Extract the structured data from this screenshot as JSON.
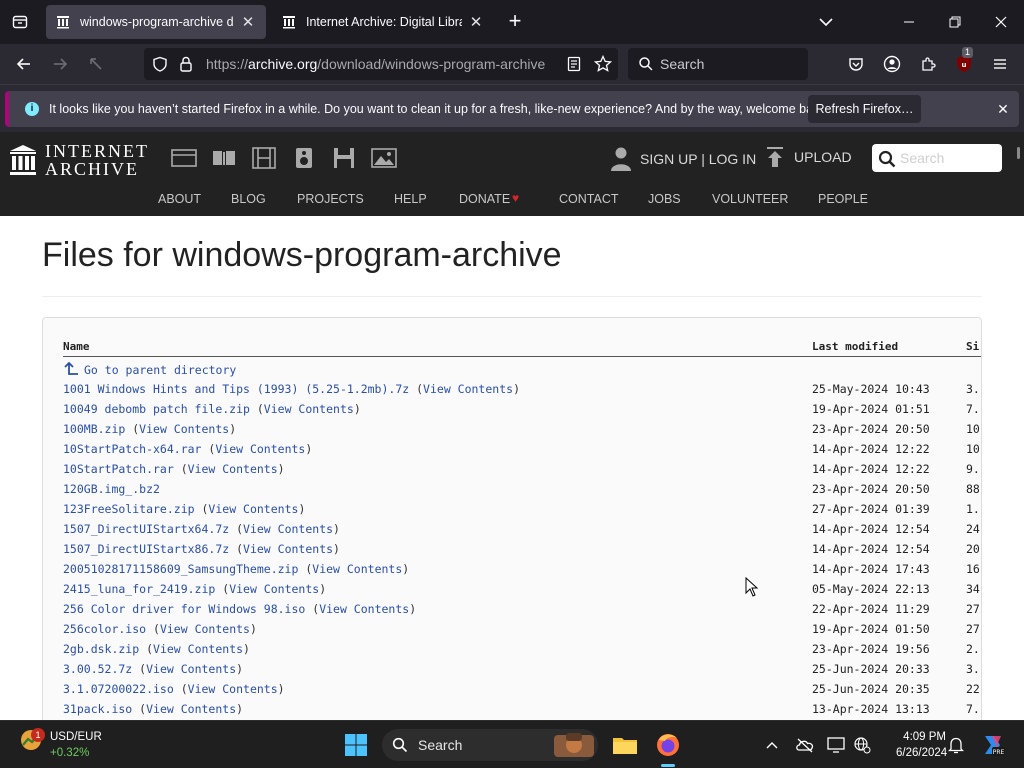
{
  "browser": {
    "tabs": [
      {
        "label": "windows-program-archive directory listing",
        "active": true
      },
      {
        "label": "Internet Archive: Digital Library of Free & Borrowable",
        "active": false
      }
    ],
    "url_prefix": "https://",
    "url_host": "archive.org",
    "url_path": "/download/windows-program-archive",
    "search_placeholder": "Search",
    "extension_badge": "1",
    "notification": {
      "message": "It looks like you haven’t started Firefox in a while. Do you want to clean it up for a fresh, like-new experience? And by the way, welcome back!",
      "button": "Refresh Firefox…"
    }
  },
  "archive": {
    "logo_line1": "INTERNET",
    "logo_line2": "ARCHIVE",
    "signup": "SIGN UP | LOG IN",
    "upload": "UPLOAD",
    "search_placeholder": "Search",
    "nav": [
      "ABOUT",
      "BLOG",
      "PROJECTS",
      "HELP",
      "DONATE",
      "CONTACT",
      "JOBS",
      "VOLUNTEER",
      "PEOPLE"
    ],
    "accent": "#d9262c"
  },
  "page": {
    "title": "Files for windows-program-archive",
    "columns": {
      "name": "Name",
      "modified": "Last modified",
      "size": "Si"
    },
    "parent": "Go to parent directory",
    "view_label": "View Contents",
    "rows": [
      {
        "name": "1001 Windows Hints and Tips (1993) (5.25-1.2mb).7z",
        "view": true,
        "date": "25-May-2024 10:43",
        "size": "3."
      },
      {
        "name": "10049 debomb patch file.zip",
        "view": true,
        "date": "19-Apr-2024 01:51",
        "size": "7."
      },
      {
        "name": "100MB.zip",
        "view": true,
        "date": "23-Apr-2024 20:50",
        "size": "10"
      },
      {
        "name": "10StartPatch-x64.rar",
        "view": true,
        "date": "14-Apr-2024 12:22",
        "size": "10"
      },
      {
        "name": "10StartPatch.rar",
        "view": true,
        "date": "14-Apr-2024 12:22",
        "size": "9."
      },
      {
        "name": "120GB.img_.bz2",
        "view": false,
        "date": "23-Apr-2024 20:50",
        "size": "88"
      },
      {
        "name": "123FreeSolitare.zip",
        "view": true,
        "date": "27-Apr-2024 01:39",
        "size": "1."
      },
      {
        "name": "1507_DirectUIStartx64.7z",
        "view": true,
        "date": "14-Apr-2024 12:54",
        "size": "24"
      },
      {
        "name": "1507_DirectUIStartx86.7z",
        "view": true,
        "date": "14-Apr-2024 12:54",
        "size": "20"
      },
      {
        "name": "20051028171158609_SamsungTheme.zip",
        "view": true,
        "date": "14-Apr-2024 17:43",
        "size": "16"
      },
      {
        "name": "2415_luna_for_2419.zip",
        "view": true,
        "date": "05-May-2024 22:13",
        "size": "34"
      },
      {
        "name": "256 Color driver for Windows 98.iso",
        "view": true,
        "date": "22-Apr-2024 11:29",
        "size": "27"
      },
      {
        "name": "256color.iso",
        "view": true,
        "date": "19-Apr-2024 01:50",
        "size": "27"
      },
      {
        "name": "2gb.dsk.zip",
        "view": true,
        "date": "23-Apr-2024 19:56",
        "size": "2."
      },
      {
        "name": "3.00.52.7z",
        "view": true,
        "date": "25-Jun-2024 20:33",
        "size": "3."
      },
      {
        "name": "3.1.07200022.iso",
        "view": true,
        "date": "25-Jun-2024 20:35",
        "size": "22"
      },
      {
        "name": "31pack.iso",
        "view": true,
        "date": "13-Apr-2024 13:13",
        "size": "7."
      }
    ]
  },
  "taskbar": {
    "weather_label": "USD/EUR",
    "weather_value": "+0.32%",
    "weather_badge": "1",
    "search": "Search",
    "time": "4:09 PM",
    "date": "6/26/2024"
  }
}
